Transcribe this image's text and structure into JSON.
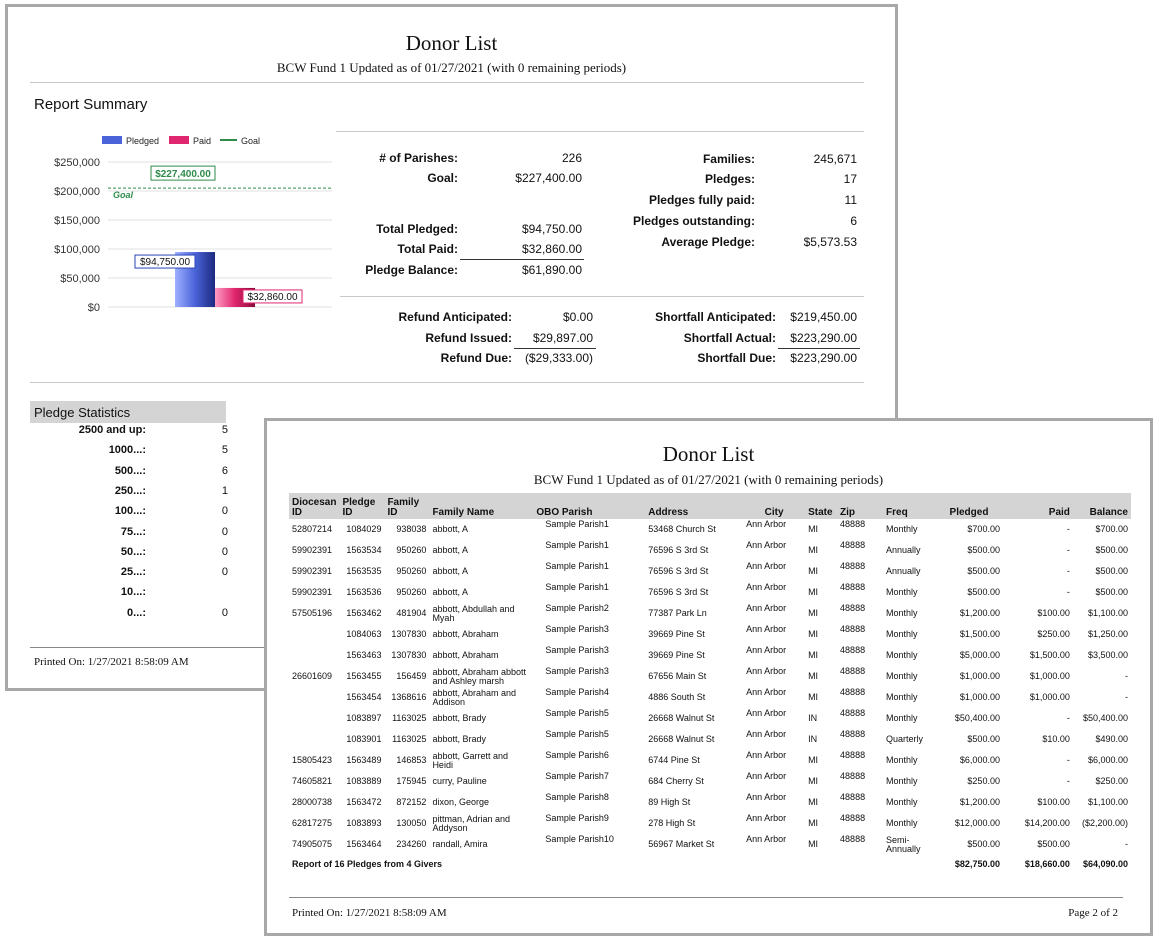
{
  "page1": {
    "title": "Donor List",
    "subtitle": "BCW Fund 1 Updated as of 01/27/2021 (with 0 remaining periods)",
    "summary_heading": "Report Summary",
    "legend": [
      "Pledged",
      "Paid",
      "Goal"
    ],
    "colors": {
      "pledged": "#4a63d8",
      "paid": "#e0266e",
      "goal": "#2e8b4a"
    },
    "summary_left": [
      {
        "label": "# of Parishes:",
        "value": "226"
      },
      {
        "label": "Goal:",
        "value": "$227,400.00"
      },
      {
        "label": "Total Pledged:",
        "value": "$94,750.00"
      },
      {
        "label": "Total Paid:",
        "value": "$32,860.00"
      },
      {
        "label": "Pledge Balance:",
        "value": "$61,890.00"
      }
    ],
    "summary_right": [
      {
        "label": "Families:",
        "value": "245,671"
      },
      {
        "label": "Pledges:",
        "value": "17"
      },
      {
        "label": "Pledges fully paid:",
        "value": "11"
      },
      {
        "label": "Pledges outstanding:",
        "value": "6"
      },
      {
        "label": "Average Pledge:",
        "value": "$5,573.53"
      }
    ],
    "refunds": [
      {
        "label": "Refund Anticipated:",
        "value": "$0.00"
      },
      {
        "label": "Refund Issued:",
        "value": "$29,897.00"
      },
      {
        "label": "Refund Due:",
        "value": "($29,333.00)"
      }
    ],
    "shortfalls": [
      {
        "label": "Shortfall Anticipated:",
        "value": "$219,450.00"
      },
      {
        "label": "Shortfall Actual:",
        "value": "$223,290.00"
      },
      {
        "label": "Shortfall Due:",
        "value": "$223,290.00"
      }
    ],
    "stats_heading": "Pledge Statistics",
    "stats": [
      {
        "label": "2500 and up:",
        "value": "5"
      },
      {
        "label": "1000...:",
        "value": "5"
      },
      {
        "label": "500...:",
        "value": "6"
      },
      {
        "label": "250...:",
        "value": "1"
      },
      {
        "label": "100...:",
        "value": "0"
      },
      {
        "label": "75...:",
        "value": "0"
      },
      {
        "label": "50...:",
        "value": "0"
      },
      {
        "label": "25...:",
        "value": "0"
      },
      {
        "label": "10...:",
        "value": ""
      },
      {
        "label": "0...:",
        "value": "0"
      }
    ],
    "printed_on": "Printed On: 1/27/2021 8:58:09 AM"
  },
  "chart_data": {
    "type": "bar",
    "categories": [
      ""
    ],
    "series": [
      {
        "name": "Pledged",
        "values": [
          94750
        ],
        "label": "$94,750.00"
      },
      {
        "name": "Paid",
        "values": [
          32860
        ],
        "label": "$32,860.00"
      }
    ],
    "goal": {
      "name": "Goal",
      "value": 227400,
      "label": "$227,400.00",
      "line_label": "Goal"
    },
    "ylim": [
      0,
      250000
    ],
    "yticks": [
      0,
      50000,
      100000,
      150000,
      200000,
      250000
    ],
    "ytick_labels": [
      "$0",
      "$50,000",
      "$100,000",
      "$150,000",
      "$200,000",
      "$250,000"
    ],
    "grid": true,
    "legend": "top"
  },
  "page2": {
    "title": "Donor List",
    "subtitle": "BCW Fund 1 Updated as of 01/27/2021 (with 0 remaining periods)",
    "columns": [
      "Diocesan ID",
      "Pledge ID",
      "Family ID",
      "Family Name",
      "OBO Parish",
      "Address",
      "City",
      "State",
      "Zip",
      "Freq",
      "Pledged",
      "Paid",
      "Balance"
    ],
    "rows": [
      [
        "52807214",
        "1084029",
        "938038",
        "abbott, A",
        "Sample Parish1",
        "53468 Church St",
        "Ann Arbor",
        "MI",
        "48888",
        "Monthly",
        "$700.00",
        "-",
        "$700.00"
      ],
      [
        "59902391",
        "1563534",
        "950260",
        "abbott, A",
        "Sample Parish1",
        "76596 S 3rd St",
        "Ann Arbor",
        "MI",
        "48888",
        "Annually",
        "$500.00",
        "-",
        "$500.00"
      ],
      [
        "59902391",
        "1563535",
        "950260",
        "abbott, A",
        "Sample Parish1",
        "76596 S 3rd St",
        "Ann Arbor",
        "MI",
        "48888",
        "Annually",
        "$500.00",
        "-",
        "$500.00"
      ],
      [
        "59902391",
        "1563536",
        "950260",
        "abbott, A",
        "Sample Parish1",
        "76596 S 3rd St",
        "Ann Arbor",
        "MI",
        "48888",
        "Monthly",
        "$500.00",
        "-",
        "$500.00"
      ],
      [
        "57505196",
        "1563462",
        "481904",
        "abbott, Abdullah and Myah",
        "Sample Parish2",
        "77387 Park Ln",
        "Ann Arbor",
        "MI",
        "48888",
        "Monthly",
        "$1,200.00",
        "$100.00",
        "$1,100.00"
      ],
      [
        "",
        "1084063",
        "1307830",
        "abbott, Abraham",
        "Sample Parish3",
        "39669 Pine St",
        "Ann Arbor",
        "MI",
        "48888",
        "Monthly",
        "$1,500.00",
        "$250.00",
        "$1,250.00"
      ],
      [
        "",
        "1563463",
        "1307830",
        "abbott, Abraham",
        "Sample Parish3",
        "39669 Pine St",
        "Ann Arbor",
        "MI",
        "48888",
        "Monthly",
        "$5,000.00",
        "$1,500.00",
        "$3,500.00"
      ],
      [
        "26601609",
        "1563455",
        "156459",
        "abbott, Abraham abbott and Ashley marsh",
        "Sample Parish3",
        "67656 Main St",
        "Ann Arbor",
        "MI",
        "48888",
        "Monthly",
        "$1,000.00",
        "$1,000.00",
        "-"
      ],
      [
        "",
        "1563454",
        "1368616",
        "abbott, Abraham and Addison",
        "Sample Parish4",
        "4886 South St",
        "Ann Arbor",
        "MI",
        "48888",
        "Monthly",
        "$1,000.00",
        "$1,000.00",
        "-"
      ],
      [
        "",
        "1083897",
        "1163025",
        "abbott, Brady",
        "Sample Parish5",
        "26668 Walnut St",
        "Ann Arbor",
        "IN",
        "48888",
        "Monthly",
        "$50,400.00",
        "-",
        "$50,400.00"
      ],
      [
        "",
        "1083901",
        "1163025",
        "abbott, Brady",
        "Sample Parish5",
        "26668 Walnut St",
        "Ann Arbor",
        "IN",
        "48888",
        "Quarterly",
        "$500.00",
        "$10.00",
        "$490.00"
      ],
      [
        "15805423",
        "1563489",
        "146853",
        "abbott, Garrett and Heidi",
        "Sample Parish6",
        "6744 Pine St",
        "Ann Arbor",
        "MI",
        "48888",
        "Monthly",
        "$6,000.00",
        "-",
        "$6,000.00"
      ],
      [
        "74605821",
        "1083889",
        "175945",
        "curry, Pauline",
        "Sample Parish7",
        "684 Cherry St",
        "Ann Arbor",
        "MI",
        "48888",
        "Monthly",
        "$250.00",
        "-",
        "$250.00"
      ],
      [
        "28000738",
        "1563472",
        "872152",
        "dixon, George",
        "Sample Parish8",
        "89 High St",
        "Ann Arbor",
        "MI",
        "48888",
        "Monthly",
        "$1,200.00",
        "$100.00",
        "$1,100.00"
      ],
      [
        "62817275",
        "1083893",
        "130050",
        "pittman, Adrian and Addyson",
        "Sample Parish9",
        "278 High St",
        "Ann Arbor",
        "MI",
        "48888",
        "Monthly",
        "$12,000.00",
        "$14,200.00",
        "($2,200.00)"
      ],
      [
        "74905075",
        "1563464",
        "234260",
        "randall, Amira",
        "Sample Parish10",
        "56967 Market St",
        "Ann Arbor",
        "MI",
        "48888",
        "Semi-Annually",
        "$500.00",
        "$500.00",
        "-"
      ]
    ],
    "footer_label": "Report of 16 Pledges from 4 Givers",
    "totals": {
      "pledged": "$82,750.00",
      "paid": "$18,660.00",
      "balance": "$64,090.00"
    },
    "printed_on": "Printed On: 1/27/2021 8:58:09 AM",
    "page_number": "Page 2 of 2"
  }
}
